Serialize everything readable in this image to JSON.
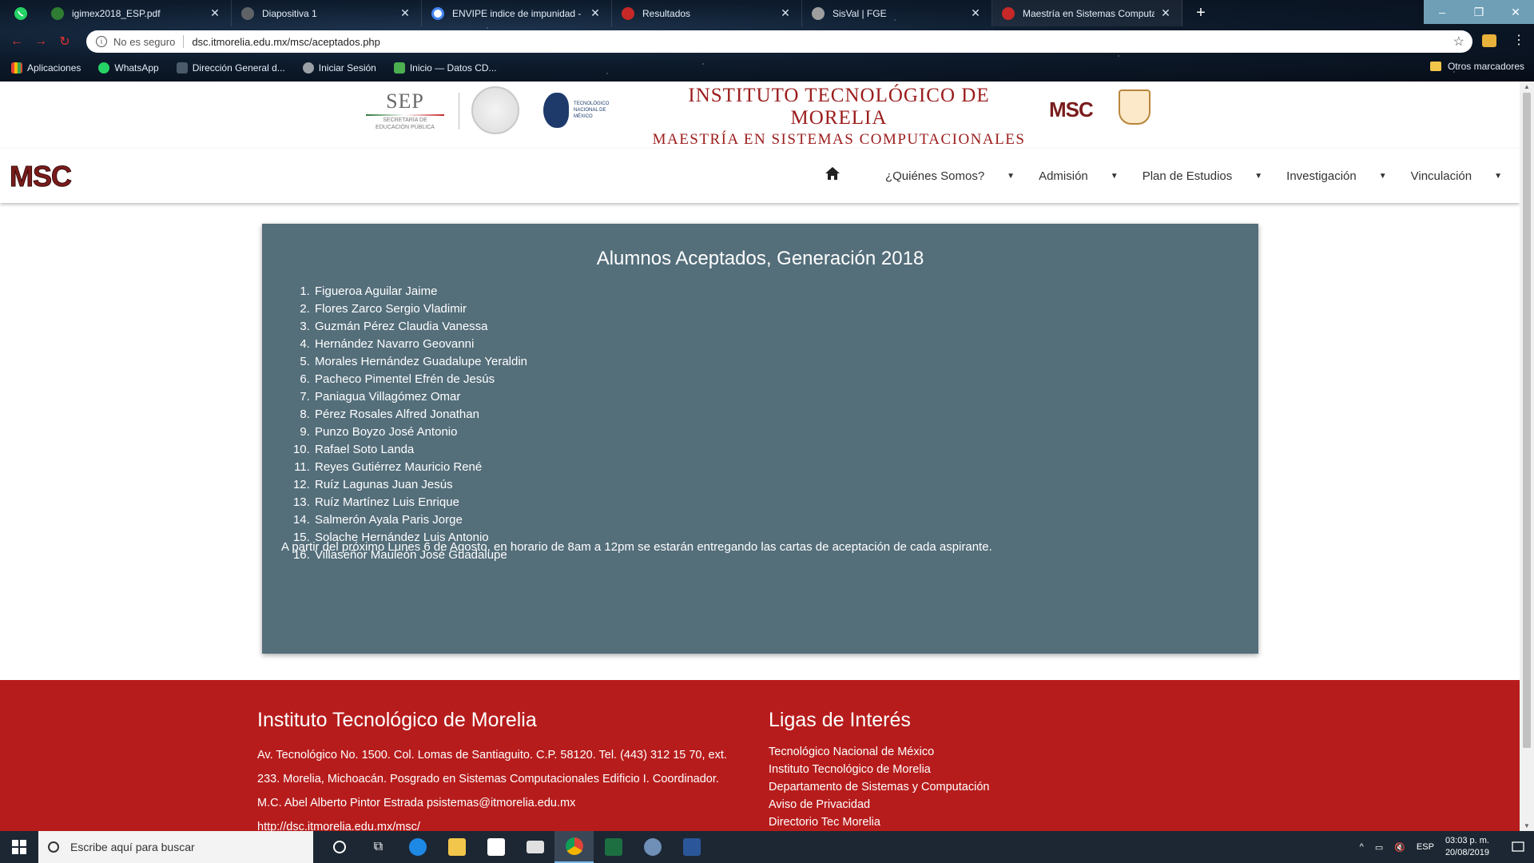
{
  "browser": {
    "tabs": [
      {
        "title": "igimex2018_ESP.pdf",
        "color": "#2e7d32",
        "active": false
      },
      {
        "title": "Diapositiva 1",
        "color": "#5f6368",
        "active": false
      },
      {
        "title": "ENVIPE indice de impunidad - Bu",
        "color": "#4285f4",
        "active": false
      },
      {
        "title": "Resultados",
        "color": "#c62828",
        "active": false
      },
      {
        "title": "SisVal | FGE",
        "color": "#9e9e9e",
        "active": false
      },
      {
        "title": "Maestría en Sistemas Computac",
        "color": "#c62828",
        "active": true
      }
    ],
    "security_label": "No es seguro",
    "url": "dsc.itmorelia.edu.mx/msc/aceptados.php",
    "bookmarks": [
      "Aplicaciones",
      "WhatsApp",
      "Dirección General d...",
      "Iniciar Sesión",
      "Inicio — Datos CD..."
    ],
    "other_bookmarks": "Otros marcadores"
  },
  "header": {
    "sep_title": "SEP",
    "sep_subtitle_1": "SECRETARÍA DE",
    "sep_subtitle_2": "EDUCACIÓN PÚBLICA",
    "tecnm_line1": "TECNOLÓGICO",
    "tecnm_line2": "NACIONAL DE MÉXICO",
    "institute": "INSTITUTO TECNOLÓGICO DE MORELIA",
    "program": "MAESTRÍA EN SISTEMAS COMPUTACIONALES",
    "msc_logo": "MSC"
  },
  "nav": {
    "brand": "MSC",
    "items": [
      "¿Quiénes Somos?",
      "Admisión",
      "Plan de Estudios",
      "Investigación",
      "Vinculación"
    ]
  },
  "panel": {
    "title": "Alumnos Aceptados, Generación 2018",
    "students": [
      "Figueroa Aguilar Jaime",
      "Flores Zarco Sergio Vladimir",
      "Guzmán Pérez Claudia Vanessa",
      "Hernández Navarro Geovanni",
      "Morales Hernández Guadalupe Yeraldin",
      "Pacheco Pimentel Efrén de Jesús",
      "Paniagua Villagómez Omar",
      "Pérez Rosales Alfred Jonathan",
      "Punzo Boyzo José Antonio",
      "Rafael Soto Landa",
      "Reyes Gutiérrez Mauricio René",
      "Ruíz Lagunas Juan Jesús",
      "Ruíz Martínez Luis Enrique",
      "Salmerón Ayala Paris Jorge",
      "Solache Hernández Luis Antonio",
      "Villaseñor Mauleón José Guadalupe"
    ],
    "notice": "A partir del próximo Lunes 6 de Agosto, en horario de 8am a 12pm se estarán entregando las cartas de aceptación de cada aspirante."
  },
  "footer": {
    "title": "Instituto Tecnológico de Morelia",
    "address": "Av. Tecnológico No. 1500. Col. Lomas de Santiaguito. C.P. 58120. Tel. (443) 312 15 70, ext. 233. Morelia, Michoacán. Posgrado en Sistemas Computacionales Edificio I. Coordinador. M.C. Abel Alberto Pintor Estrada psistemas@itmorelia.edu.mx",
    "site_url": "http://dsc.itmorelia.edu.mx/msc/",
    "links_title": "Ligas de Interés",
    "links": [
      "Tecnológico Nacional de México",
      "Instituto Tecnológico de Morelia",
      "Departamento de Sistemas y Computación",
      "Aviso de Privacidad",
      "Directorio Tec Morelia"
    ]
  },
  "taskbar": {
    "search_placeholder": "Escribe aquí para buscar",
    "language": "ESP",
    "time": "03:03 p. m.",
    "date": "20/08/2019"
  },
  "colors": {
    "panel_bg": "#546e7a",
    "footer_bg": "#b71c1c",
    "brand": "#7a1c1c"
  }
}
